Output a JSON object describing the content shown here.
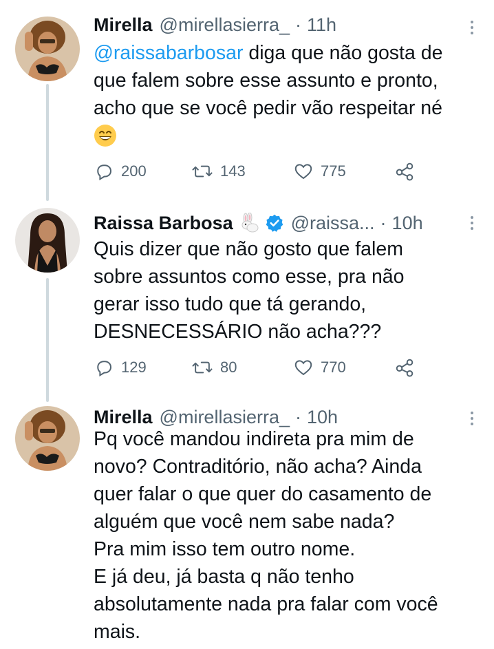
{
  "tweets": [
    {
      "name": "Mirella",
      "handle": "@mirellasierra_",
      "time": "11h",
      "mention": "@raissabarbosar",
      "lines": [
        " diga que não gosta de",
        "que falem sobre esse assunto e pronto,",
        "acho que se você pedir vão respeitar né"
      ],
      "emoji": "grinning-face-smiling-eyes",
      "replies": "200",
      "retweets": "143",
      "likes": "775"
    },
    {
      "name": "Raissa Barbosa",
      "name_emoji": "rabbit",
      "verified": true,
      "handle": "@raissa...",
      "time": "10h",
      "lines": [
        "Quis dizer que não gosto que falem",
        "sobre assuntos como esse, pra não",
        "gerar isso tudo que tá gerando,",
        "DESNECESSÁRIO não acha???"
      ],
      "replies": "129",
      "retweets": "80",
      "likes": "770"
    },
    {
      "name": "Mirella",
      "handle": "@mirellasierra_",
      "time": "10h",
      "lines": [
        "Pq você mandou indireta pra mim de",
        "novo? Contraditório, não acha? Ainda",
        "quer falar o que quer do casamento de",
        "alguém que você nem sabe nada?",
        "Pra mim isso tem outro nome.",
        "E já deu, já basta q não tenho",
        "absolutamente nada pra falar com você",
        "mais."
      ]
    }
  ],
  "separator": "·",
  "colors": {
    "text": "#0f1419",
    "secondary": "#536471",
    "link": "#1d9bf0",
    "thread": "#cfd9de"
  },
  "icons": [
    "reply-icon",
    "retweet-icon",
    "like-icon",
    "share-icon",
    "more-icon",
    "verified-badge-icon"
  ]
}
